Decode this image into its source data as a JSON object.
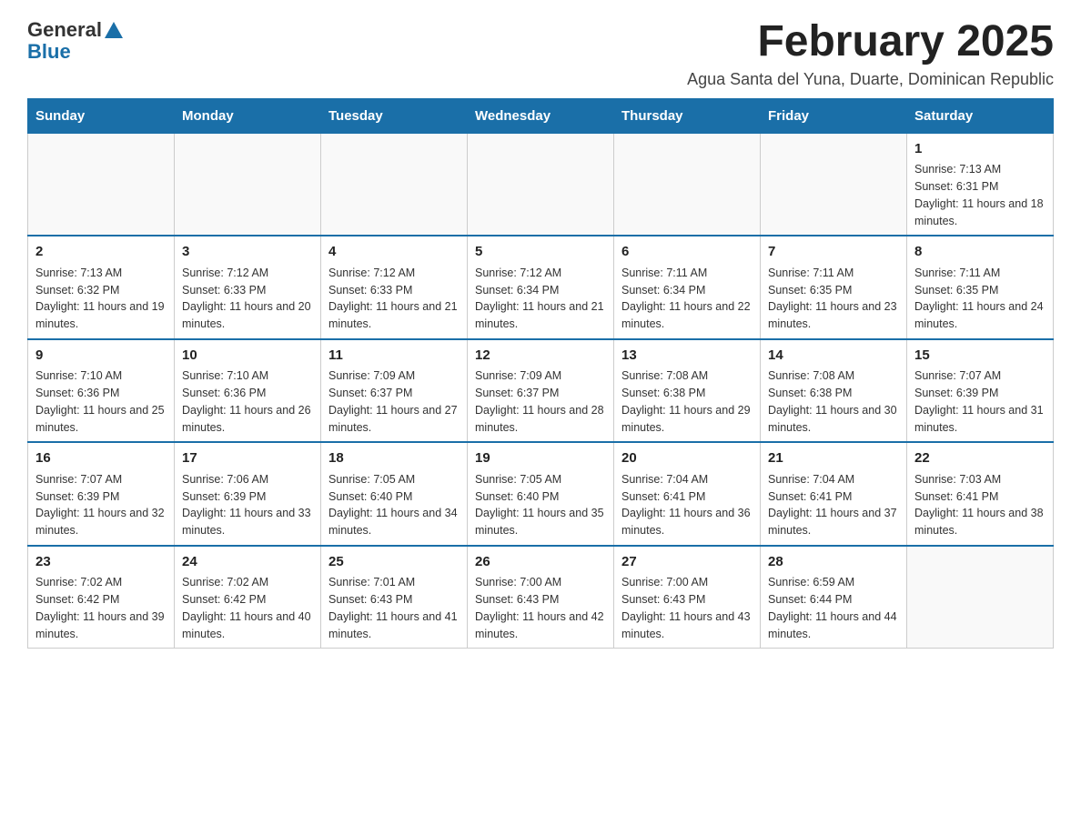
{
  "logo": {
    "general": "General",
    "blue": "Blue"
  },
  "header": {
    "month_year": "February 2025",
    "location": "Agua Santa del Yuna, Duarte, Dominican Republic"
  },
  "columns": [
    "Sunday",
    "Monday",
    "Tuesday",
    "Wednesday",
    "Thursday",
    "Friday",
    "Saturday"
  ],
  "weeks": [
    [
      {
        "day": "",
        "sunrise": "",
        "sunset": "",
        "daylight": ""
      },
      {
        "day": "",
        "sunrise": "",
        "sunset": "",
        "daylight": ""
      },
      {
        "day": "",
        "sunrise": "",
        "sunset": "",
        "daylight": ""
      },
      {
        "day": "",
        "sunrise": "",
        "sunset": "",
        "daylight": ""
      },
      {
        "day": "",
        "sunrise": "",
        "sunset": "",
        "daylight": ""
      },
      {
        "day": "",
        "sunrise": "",
        "sunset": "",
        "daylight": ""
      },
      {
        "day": "1",
        "sunrise": "Sunrise: 7:13 AM",
        "sunset": "Sunset: 6:31 PM",
        "daylight": "Daylight: 11 hours and 18 minutes."
      }
    ],
    [
      {
        "day": "2",
        "sunrise": "Sunrise: 7:13 AM",
        "sunset": "Sunset: 6:32 PM",
        "daylight": "Daylight: 11 hours and 19 minutes."
      },
      {
        "day": "3",
        "sunrise": "Sunrise: 7:12 AM",
        "sunset": "Sunset: 6:33 PM",
        "daylight": "Daylight: 11 hours and 20 minutes."
      },
      {
        "day": "4",
        "sunrise": "Sunrise: 7:12 AM",
        "sunset": "Sunset: 6:33 PM",
        "daylight": "Daylight: 11 hours and 21 minutes."
      },
      {
        "day": "5",
        "sunrise": "Sunrise: 7:12 AM",
        "sunset": "Sunset: 6:34 PM",
        "daylight": "Daylight: 11 hours and 21 minutes."
      },
      {
        "day": "6",
        "sunrise": "Sunrise: 7:11 AM",
        "sunset": "Sunset: 6:34 PM",
        "daylight": "Daylight: 11 hours and 22 minutes."
      },
      {
        "day": "7",
        "sunrise": "Sunrise: 7:11 AM",
        "sunset": "Sunset: 6:35 PM",
        "daylight": "Daylight: 11 hours and 23 minutes."
      },
      {
        "day": "8",
        "sunrise": "Sunrise: 7:11 AM",
        "sunset": "Sunset: 6:35 PM",
        "daylight": "Daylight: 11 hours and 24 minutes."
      }
    ],
    [
      {
        "day": "9",
        "sunrise": "Sunrise: 7:10 AM",
        "sunset": "Sunset: 6:36 PM",
        "daylight": "Daylight: 11 hours and 25 minutes."
      },
      {
        "day": "10",
        "sunrise": "Sunrise: 7:10 AM",
        "sunset": "Sunset: 6:36 PM",
        "daylight": "Daylight: 11 hours and 26 minutes."
      },
      {
        "day": "11",
        "sunrise": "Sunrise: 7:09 AM",
        "sunset": "Sunset: 6:37 PM",
        "daylight": "Daylight: 11 hours and 27 minutes."
      },
      {
        "day": "12",
        "sunrise": "Sunrise: 7:09 AM",
        "sunset": "Sunset: 6:37 PM",
        "daylight": "Daylight: 11 hours and 28 minutes."
      },
      {
        "day": "13",
        "sunrise": "Sunrise: 7:08 AM",
        "sunset": "Sunset: 6:38 PM",
        "daylight": "Daylight: 11 hours and 29 minutes."
      },
      {
        "day": "14",
        "sunrise": "Sunrise: 7:08 AM",
        "sunset": "Sunset: 6:38 PM",
        "daylight": "Daylight: 11 hours and 30 minutes."
      },
      {
        "day": "15",
        "sunrise": "Sunrise: 7:07 AM",
        "sunset": "Sunset: 6:39 PM",
        "daylight": "Daylight: 11 hours and 31 minutes."
      }
    ],
    [
      {
        "day": "16",
        "sunrise": "Sunrise: 7:07 AM",
        "sunset": "Sunset: 6:39 PM",
        "daylight": "Daylight: 11 hours and 32 minutes."
      },
      {
        "day": "17",
        "sunrise": "Sunrise: 7:06 AM",
        "sunset": "Sunset: 6:39 PM",
        "daylight": "Daylight: 11 hours and 33 minutes."
      },
      {
        "day": "18",
        "sunrise": "Sunrise: 7:05 AM",
        "sunset": "Sunset: 6:40 PM",
        "daylight": "Daylight: 11 hours and 34 minutes."
      },
      {
        "day": "19",
        "sunrise": "Sunrise: 7:05 AM",
        "sunset": "Sunset: 6:40 PM",
        "daylight": "Daylight: 11 hours and 35 minutes."
      },
      {
        "day": "20",
        "sunrise": "Sunrise: 7:04 AM",
        "sunset": "Sunset: 6:41 PM",
        "daylight": "Daylight: 11 hours and 36 minutes."
      },
      {
        "day": "21",
        "sunrise": "Sunrise: 7:04 AM",
        "sunset": "Sunset: 6:41 PM",
        "daylight": "Daylight: 11 hours and 37 minutes."
      },
      {
        "day": "22",
        "sunrise": "Sunrise: 7:03 AM",
        "sunset": "Sunset: 6:41 PM",
        "daylight": "Daylight: 11 hours and 38 minutes."
      }
    ],
    [
      {
        "day": "23",
        "sunrise": "Sunrise: 7:02 AM",
        "sunset": "Sunset: 6:42 PM",
        "daylight": "Daylight: 11 hours and 39 minutes."
      },
      {
        "day": "24",
        "sunrise": "Sunrise: 7:02 AM",
        "sunset": "Sunset: 6:42 PM",
        "daylight": "Daylight: 11 hours and 40 minutes."
      },
      {
        "day": "25",
        "sunrise": "Sunrise: 7:01 AM",
        "sunset": "Sunset: 6:43 PM",
        "daylight": "Daylight: 11 hours and 41 minutes."
      },
      {
        "day": "26",
        "sunrise": "Sunrise: 7:00 AM",
        "sunset": "Sunset: 6:43 PM",
        "daylight": "Daylight: 11 hours and 42 minutes."
      },
      {
        "day": "27",
        "sunrise": "Sunrise: 7:00 AM",
        "sunset": "Sunset: 6:43 PM",
        "daylight": "Daylight: 11 hours and 43 minutes."
      },
      {
        "day": "28",
        "sunrise": "Sunrise: 6:59 AM",
        "sunset": "Sunset: 6:44 PM",
        "daylight": "Daylight: 11 hours and 44 minutes."
      },
      {
        "day": "",
        "sunrise": "",
        "sunset": "",
        "daylight": ""
      }
    ]
  ]
}
